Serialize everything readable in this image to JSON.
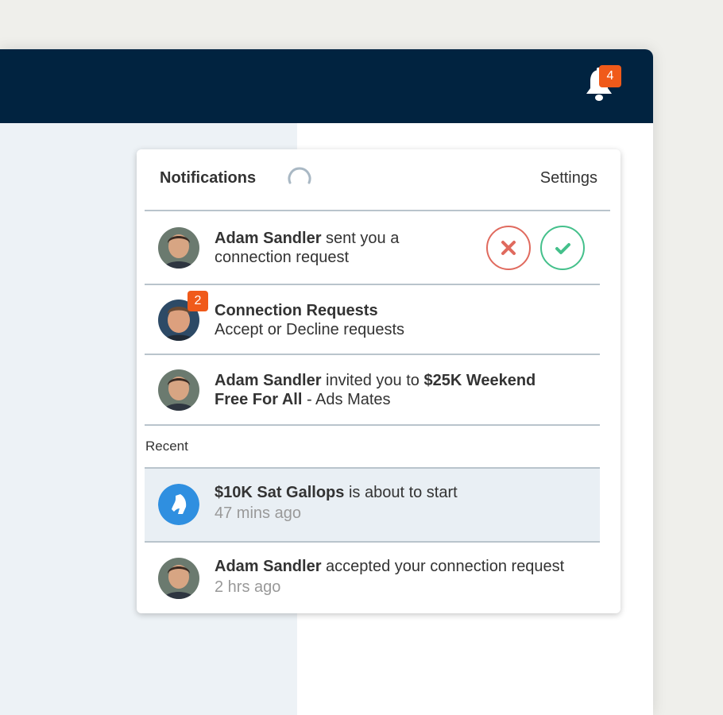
{
  "header": {
    "bell_badge_count": "4"
  },
  "panel": {
    "title": "Notifications",
    "settings_label": "Settings"
  },
  "notifications": [
    {
      "actor": "Adam Sandler",
      "text_line1": " sent you a",
      "text_line2": "connection request",
      "avatar_icon": "person-avatar"
    },
    {
      "title": "Connection Requests",
      "subtitle": "Accept or Decline requests",
      "badge": "2",
      "avatar_icon": "person-avatar"
    },
    {
      "actor": "Adam Sandler",
      "text_mid": " invited you to ",
      "event_line1": "$25K Weekend",
      "event_line2": "Free For All",
      "text_end": " - Ads Mates",
      "avatar_icon": "person-avatar"
    }
  ],
  "recent_label": "Recent",
  "recent": [
    {
      "event": "$10K Sat Gallops",
      "text": " is about to start",
      "time": "47 mins ago",
      "avatar_icon": "horse-icon"
    },
    {
      "actor": "Adam Sandler",
      "text": " accepted your connection request",
      "time": "2 hrs ago",
      "avatar_icon": "person-avatar"
    }
  ],
  "colors": {
    "top_bar": "#012340",
    "badge": "#f05a1a",
    "decline": "#e06a5e",
    "accept": "#44c08b",
    "horse_icon_bg": "#2f8fe0"
  }
}
